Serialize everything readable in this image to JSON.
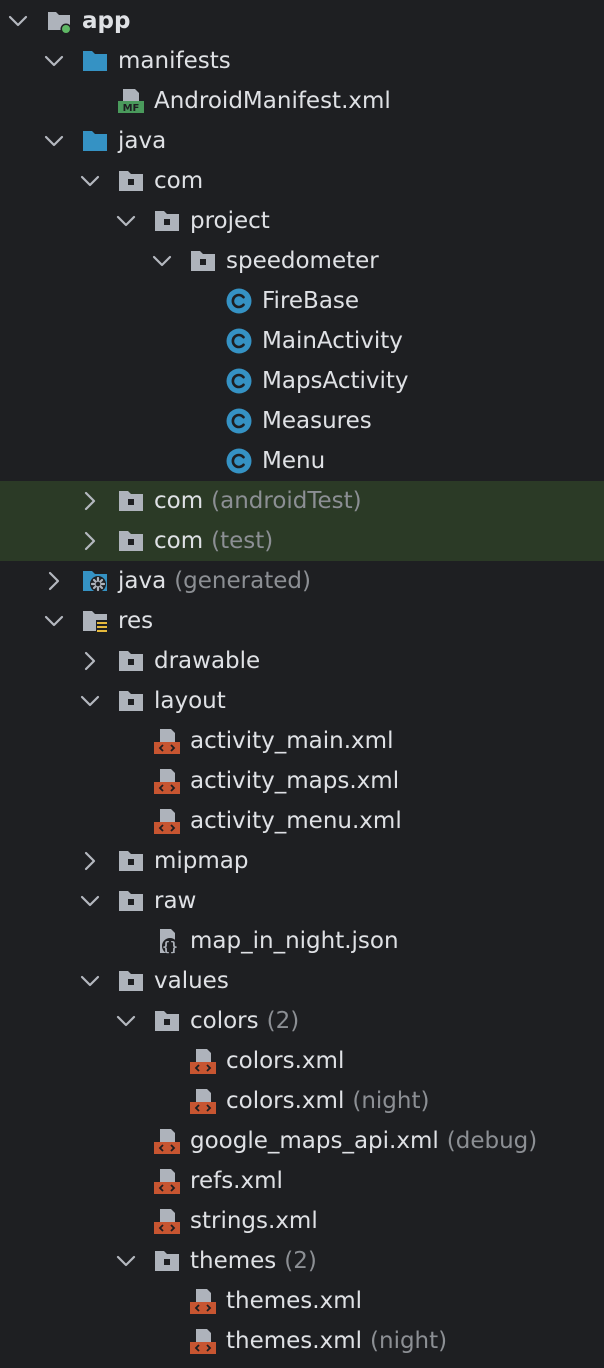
{
  "tree": [
    {
      "label": "app",
      "type": "module",
      "depth": 0,
      "state": "expanded",
      "bold": true
    },
    {
      "label": "manifests",
      "type": "folder-blue",
      "depth": 1,
      "state": "expanded"
    },
    {
      "label": "AndroidManifest.xml",
      "type": "manifest",
      "depth": 2,
      "state": "leaf"
    },
    {
      "label": "java",
      "type": "folder-blue",
      "depth": 1,
      "state": "expanded"
    },
    {
      "label": "com",
      "type": "package",
      "depth": 2,
      "state": "expanded"
    },
    {
      "label": "project",
      "type": "package",
      "depth": 3,
      "state": "expanded"
    },
    {
      "label": "speedometer",
      "type": "package",
      "depth": 4,
      "state": "expanded"
    },
    {
      "label": "FireBase",
      "type": "class",
      "depth": 5,
      "state": "leaf"
    },
    {
      "label": "MainActivity",
      "type": "class",
      "depth": 5,
      "state": "leaf"
    },
    {
      "label": "MapsActivity",
      "type": "class",
      "depth": 5,
      "state": "leaf"
    },
    {
      "label": "Measures",
      "type": "class",
      "depth": 5,
      "state": "leaf"
    },
    {
      "label": "Menu",
      "type": "class",
      "depth": 5,
      "state": "leaf"
    },
    {
      "label": "com",
      "suffix": "(androidTest)",
      "type": "package",
      "depth": 2,
      "state": "collapsed",
      "highlight": true
    },
    {
      "label": "com",
      "suffix": "(test)",
      "type": "package",
      "depth": 2,
      "state": "collapsed",
      "highlight": true
    },
    {
      "label": "java",
      "suffix": "(generated)",
      "type": "generated",
      "depth": 1,
      "state": "collapsed"
    },
    {
      "label": "res",
      "type": "res",
      "depth": 1,
      "state": "expanded"
    },
    {
      "label": "drawable",
      "type": "package",
      "depth": 2,
      "state": "collapsed"
    },
    {
      "label": "layout",
      "type": "package",
      "depth": 2,
      "state": "expanded"
    },
    {
      "label": "activity_main.xml",
      "type": "xml",
      "depth": 3,
      "state": "leaf"
    },
    {
      "label": "activity_maps.xml",
      "type": "xml",
      "depth": 3,
      "state": "leaf"
    },
    {
      "label": "activity_menu.xml",
      "type": "xml",
      "depth": 3,
      "state": "leaf"
    },
    {
      "label": "mipmap",
      "type": "package",
      "depth": 2,
      "state": "collapsed"
    },
    {
      "label": "raw",
      "type": "package",
      "depth": 2,
      "state": "expanded"
    },
    {
      "label": "map_in_night.json",
      "type": "json",
      "depth": 3,
      "state": "leaf"
    },
    {
      "label": "values",
      "type": "package",
      "depth": 2,
      "state": "expanded"
    },
    {
      "label": "colors",
      "suffix": "(2)",
      "type": "package",
      "depth": 3,
      "state": "expanded"
    },
    {
      "label": "colors.xml",
      "type": "xml",
      "depth": 4,
      "state": "leaf"
    },
    {
      "label": "colors.xml",
      "suffix": "(night)",
      "type": "xml",
      "depth": 4,
      "state": "leaf"
    },
    {
      "label": "google_maps_api.xml",
      "suffix": "(debug)",
      "type": "xml",
      "depth": 3,
      "state": "leaf"
    },
    {
      "label": "refs.xml",
      "type": "xml",
      "depth": 3,
      "state": "leaf"
    },
    {
      "label": "strings.xml",
      "type": "xml",
      "depth": 3,
      "state": "leaf"
    },
    {
      "label": "themes",
      "suffix": "(2)",
      "type": "package",
      "depth": 3,
      "state": "expanded"
    },
    {
      "label": "themes.xml",
      "type": "xml",
      "depth": 4,
      "state": "leaf"
    },
    {
      "label": "themes.xml",
      "suffix": "(night)",
      "type": "xml",
      "depth": 4,
      "state": "leaf"
    }
  ],
  "colors": {
    "background": "#1e1f22",
    "text": "#dfe1e5",
    "suffix": "#8c8f94",
    "highlight": "#2b3a26",
    "folder_blue": "#3592c4",
    "folder_gray": "#aeb3bb",
    "class_icon": "#3592c4",
    "xml_icon": "#c75531",
    "manifest_icon": "#4a9a5c",
    "module_dot": "#5fb865"
  }
}
